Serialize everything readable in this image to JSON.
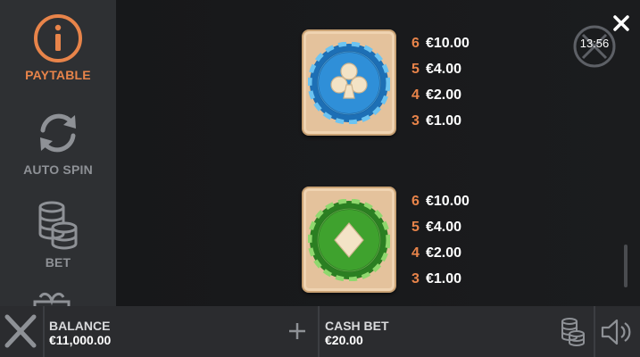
{
  "sidebar": {
    "items": [
      {
        "label": "PAYTABLE",
        "icon": "info-icon",
        "active": true
      },
      {
        "label": "AUTO SPIN",
        "icon": "refresh-icon",
        "active": false
      },
      {
        "label": "BET",
        "icon": "coin-stack-icon",
        "active": false
      }
    ]
  },
  "paytable": {
    "symbols": [
      {
        "name": "club-chip",
        "icon": "club-icon",
        "color": "#2f8fd8",
        "payouts": [
          {
            "count": "6",
            "value": "€10.00"
          },
          {
            "count": "5",
            "value": "€4.00"
          },
          {
            "count": "4",
            "value": "€2.00"
          },
          {
            "count": "3",
            "value": "€1.00"
          }
        ]
      },
      {
        "name": "diamond-chip",
        "icon": "diamond-icon",
        "color": "#3fa22e",
        "payouts": [
          {
            "count": "6",
            "value": "€10.00"
          },
          {
            "count": "5",
            "value": "€4.00"
          },
          {
            "count": "4",
            "value": "€2.00"
          },
          {
            "count": "3",
            "value": "€1.00"
          }
        ]
      }
    ]
  },
  "clock": {
    "time": "13:56"
  },
  "bottom_bar": {
    "balance_label": "BALANCE",
    "balance_value": "€11,000.00",
    "cash_bet_label": "CASH BET",
    "cash_bet_value": "€20.00"
  },
  "colors": {
    "accent": "#e8844a",
    "sidebar_bg": "#2e3033",
    "bar_bg": "#2b2c2f"
  }
}
